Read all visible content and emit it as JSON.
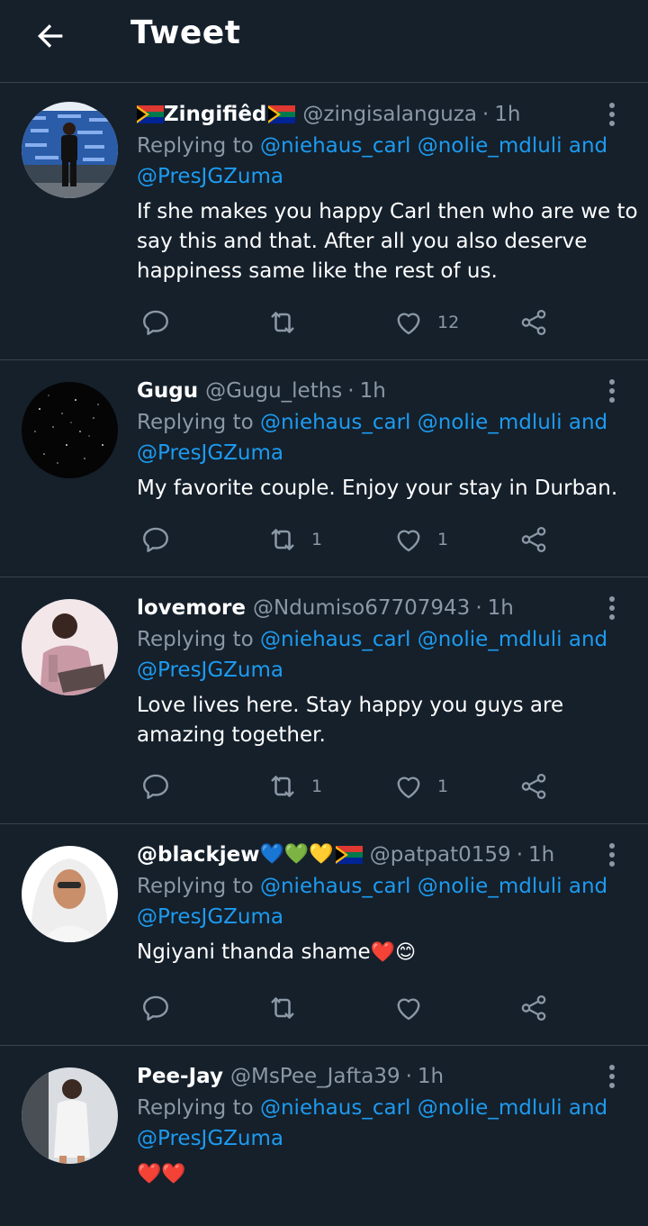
{
  "header": {
    "title": "Tweet",
    "back_icon": "arrow-left-icon"
  },
  "colors": {
    "background": "#15202b",
    "accent": "#1d9bf0",
    "muted": "#8b98a5",
    "divider": "#38444d"
  },
  "tweets": [
    {
      "name": "Zingifiêd",
      "name_suffix": "",
      "handle": "@zingisalanguza",
      "time": "1h",
      "reply_prefix": "Replying to",
      "mentions": [
        "@niehaus_carl",
        "@nolie_mdluli",
        "and",
        "@PresJGZuma"
      ],
      "text": "If she makes you happy Carl then who are we to say this and that. After all you also deserve happiness same like the rest of us.",
      "retweets": "",
      "likes": "12"
    },
    {
      "name": "Gugu",
      "handle": "@Gugu_leths",
      "time": "1h",
      "reply_prefix": "Replying to",
      "mentions": [
        "@niehaus_carl",
        "@nolie_mdluli",
        "and",
        "@PresJGZuma"
      ],
      "text": "My favorite couple. Enjoy your stay in Durban.",
      "retweets": "1",
      "likes": "1"
    },
    {
      "name": "lovemore",
      "handle": "@Ndumiso67707943",
      "time": "1h",
      "reply_prefix": "Replying to",
      "mentions": [
        "@niehaus_carl",
        "@nolie_mdluli",
        "and",
        "@PresJGZuma"
      ],
      "text": "Love lives here. Stay happy you guys are amazing together.",
      "retweets": "1",
      "likes": "1"
    },
    {
      "name": "@blackjew",
      "name_emojis": "💙💚💛",
      "handle": "@patpat0159",
      "time": "1h",
      "reply_prefix": "Replying to",
      "mentions": [
        "@niehaus_carl",
        "@nolie_mdluli",
        "and",
        "@PresJGZuma"
      ],
      "text": "Ngiyani thanda shame",
      "text_emojis": "❤️😊",
      "retweets": "",
      "likes": ""
    },
    {
      "name": "Pee-Jay",
      "handle": "@MsPee_Jafta39",
      "time": "1h",
      "reply_prefix": "Replying to",
      "mentions": [
        "@niehaus_carl",
        "@nolie_mdluli",
        "and",
        "@PresJGZuma"
      ],
      "text": "",
      "text_emojis": "❤️❤️"
    }
  ],
  "separator": "·"
}
